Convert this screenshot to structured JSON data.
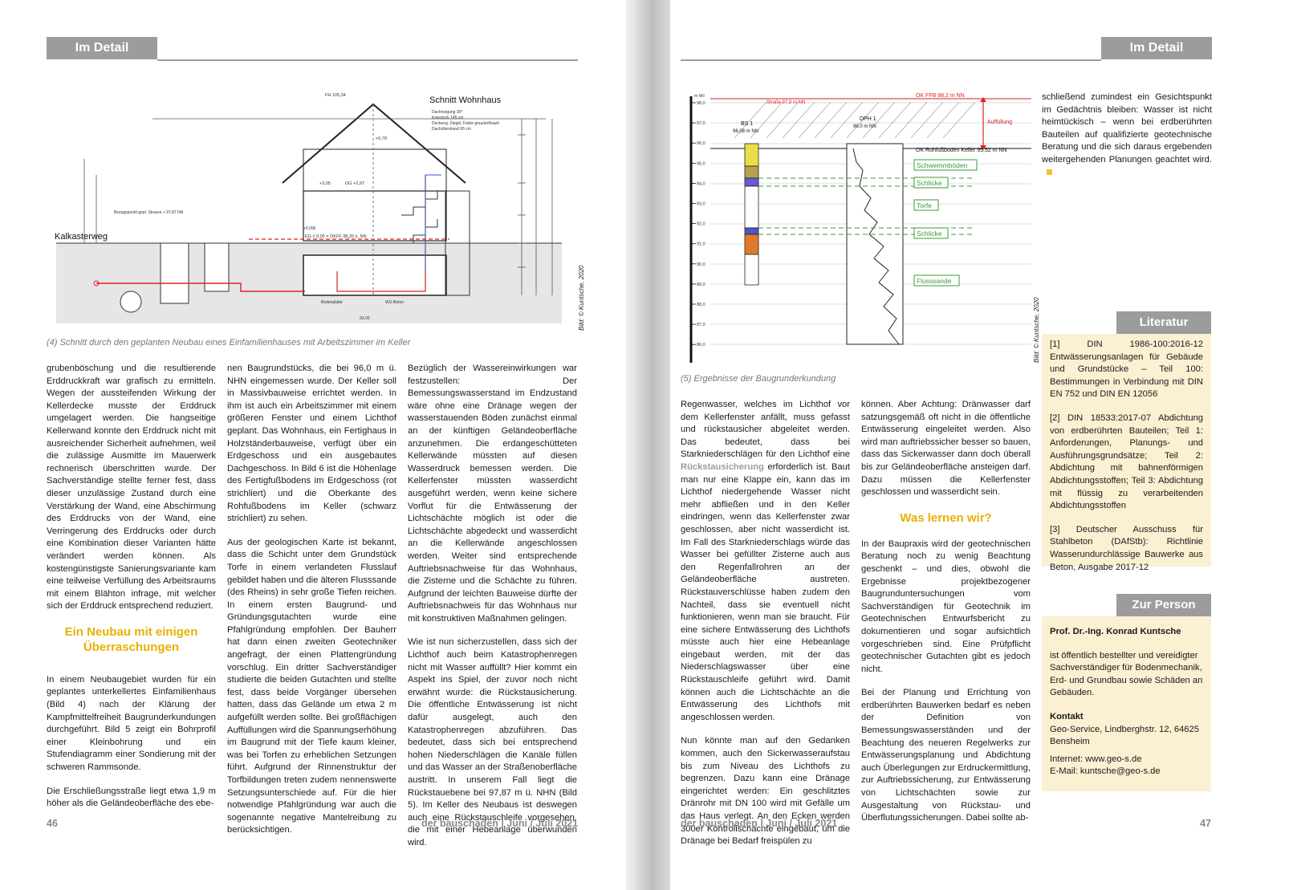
{
  "header": {
    "left_label": "Im Detail",
    "right_label": "Im Detail"
  },
  "figure4": {
    "title": "Schnitt Wohnhaus",
    "street": "Kalkasterweg",
    "caption": "(4) Schnitt durch den geplanten Neubau eines Einfamilienhauses mit Arbeitszimmer im Keller",
    "credit": "Bild: © Kuntsche, 2020",
    "roof_notes": [
      "Dachneigung 30°",
      "Kniestock 145 cm",
      "Deckung: Ziegel, Farbe grau/anthrazit",
      "Dachüberstand 95 cm"
    ],
    "labels": {
      "fh": "FH 105,34",
      "eg": "EG ± 0,00 = OKFF 98,20 ü. NN",
      "og": "OG +2,97",
      "dg": "+5,78",
      "eg2": "+3,05",
      "bezug": "Bezugspunkt gepl. Strasse + 97,87 NN",
      "kellersohle": "+0,095",
      "bodenplatte": "Bodenplatte",
      "wasserdicht": "WU-Beton",
      "abs": "93,00"
    }
  },
  "figure5": {
    "caption": "(5) Ergebnisse der Baugrunderkundung",
    "credit": "Bild: © Kuntsche, 2020",
    "ok_ffb": "OK FFB 98,2 m NN",
    "strasse": "Straße 97,8 m NN",
    "ok_rohfussboden": "OK Rohfußboden Keller 95,52 m NN",
    "auffuellung": "Auffüllung",
    "bs1": "BS 1",
    "bs1_level": "96,08 m NN",
    "dph1": "DPH 1",
    "dph1_level": "96,0 m NN",
    "axis_label": "m NN",
    "y_ticks": [
      "98,0",
      "97,0",
      "96,0",
      "95,0",
      "94,0",
      "93,0",
      "92,0",
      "91,0",
      "90,0",
      "89,0",
      "88,0",
      "87,0",
      "86,0"
    ],
    "layers": [
      "Schwemmböden",
      "Schlicke",
      "Torfe",
      "Schlicke",
      "Flusssande"
    ]
  },
  "left": {
    "col1": {
      "p1": "grubenböschung und die resultierende Erddruckkraft war grafisch zu ermitteln. Wegen der aussteifenden Wirkung der Kellerdecke musste der Erddruck umgelagert werden. Die hangseitige Kellerwand konnte den Erddruck nicht mit ausreichender Sicherheit aufnehmen, weil die zulässige Ausmitte im Mauerwerk rechnerisch überschritten wurde. Der Sachverständige stellte ferner fest, dass dieser unzulässige Zustand durch eine Verstärkung der Wand, eine Abschirmung des Erddrucks von der Wand, eine Verringerung des Erddrucks oder durch eine Kombination dieser Varianten hätte verändert werden können. Als kostengünstigste Sanierungsvariante kam eine teilweise Verfüllung des Arbeitsraums mit einem Blähton infrage, mit welcher sich der Erddruck entsprechend reduziert.",
      "heading": "Ein Neubau mit einigen Überraschungen",
      "p2": "In einem Neubaugebiet wurden für ein geplantes unterkellertes Einfamilienhaus (Bild 4) nach der Klärung der Kampfmittelfreiheit Baugrunderkundungen durchgeführt. Bild 5 zeigt ein Bohrprofil einer Kleinbohrung und ein Stufendiagramm einer Sondierung mit der schweren Rammsonde.",
      "p3": "Die Erschließungsstraße liegt etwa 1,9 m höher als die Geländeoberfläche des ebe-"
    },
    "col2": {
      "p1": "nen Baugrundstücks, die bei 96,0 m ü. NHN eingemessen wurde. Der Keller soll in Massivbauweise errichtet werden. In ihm ist auch ein Arbeitszimmer mit einem größeren Fenster und einem Lichthof geplant. Das Wohnhaus, ein Fertighaus in Holzständerbauweise, verfügt über ein Erdgeschoss und ein ausgebautes Dachgeschoss. In Bild 6 ist die Höhenlage des Fertigfußbodens im Erdgeschoss (rot strichliert) und die Oberkante des Rohfußbodens im Keller (schwarz strichliert) zu sehen.",
      "p2": "Aus der geologischen Karte ist bekannt, dass die Schicht unter dem Grundstück Torfe in einem verlandeten Flusslauf gebildet haben und die älteren Flusssande (des Rheins) in sehr große Tiefen reichen. In einem ersten Baugrund- und Gründungsgutachten wurde eine Pfahlgründung empfohlen. Der Bauherr hat dann einen zweiten Geotechniker angefragt, der einen Plattengründung vorschlug. Ein dritter Sachverständiger studierte die beiden Gutachten und stellte fest, dass beide Vorgänger übersehen hatten, dass das Gelände um etwa 2 m aufgefüllt werden sollte. Bei großflächigen Auffüllungen wird die Spannungserhöhung im Baugrund mit der Tiefe kaum kleiner, was bei Torfen zu erheblichen Setzungen führt. Aufgrund der Rinnenstruktur der Torfbildungen treten zudem nennenswerte Setzungsunterschiede auf. Für die hier notwendige Pfahlgründung war auch die sogenannte negative Mantelreibung zu berücksichtigen."
    },
    "col3": {
      "p1": "Bezüglich der Wassereinwirkungen war festzustellen: Der Bemessungswasserstand im Endzustand wäre ohne eine Dränage wegen der wasserstauenden Böden zunächst einmal an der künftigen Geländeoberfläche anzunehmen. Die erdangeschütteten Kellerwände müssten auf diesen Wasserdruck bemessen werden. Die Kellerfenster müssten wasserdicht ausgeführt werden, wenn keine sichere Vorflut für die Entwässerung der Lichtschächte möglich ist oder die Lichtschächte abgedeckt und wasserdicht an die Kellerwände angeschlossen werden. Weiter sind entsprechende Auftriebsnachweise für das Wohnhaus, die Zisterne und die Schächte zu führen. Aufgrund der leichten Bauweise dürfte der Auftriebsnachweis für das Wohnhaus nur mit konstruktiven Maßnahmen gelingen.",
      "p2": "Wie ist nun sicherzustellen, dass sich der Lichthof auch beim Katastrophenregen nicht mit Wasser auffüllt? Hier kommt ein Aspekt ins Spiel, der zuvor noch nicht erwähnt wurde: die Rückstausicherung. Die öffentliche Entwässerung ist nicht dafür ausgelegt, auch den Katastrophenregen abzuführen. Das bedeutet, dass sich bei entsprechend hohen Niederschlägen die Kanäle füllen und das Wasser an der Straßenoberfläche austritt. In unserem Fall liegt die Rückstauebene bei 97,87 m ü. NHN (Bild 5). Im Keller des Neubaus ist deswegen auch eine Rückstauschleife vorgesehen, die mit einer Hebeanlage überwunden wird."
    },
    "folio_num": "46",
    "folio_title": "der bauschaden | Juni / Juli 2021"
  },
  "right": {
    "col1": {
      "p1_a": "Regenwasser, welches im Lichthof vor dem Kellerfenster anfällt, muss gefasst und rückstausicher abgeleitet werden. Das bedeutet, dass bei Starkniederschlägen für den Lichthof eine ",
      "p1_hl": "Rückstausicherung",
      "p1_b": " erforderlich ist. Baut man nur eine Klappe ein, kann das im Lichthof niedergehende Wasser nicht mehr abfließen und in den Keller eindringen, wenn das Kellerfenster zwar geschlossen, aber nicht wasserdicht ist. Im Fall des Starkniederschlags würde das Wasser bei gefüllter Zisterne auch aus den Regenfallrohren an der Geländeoberfläche austreten. Rückstauverschlüsse haben zudem den Nachteil, dass sie eventuell nicht funktionieren, wenn man sie braucht. Für eine sichere Entwässerung des Lichthofs müsste auch hier eine Hebeanlage eingebaut werden, mit der das Niederschlagswasser über eine Rückstauschleife geführt wird. Damit können auch die Lichtschächte an die Entwässerung des Lichthofs mit angeschlossen werden.",
      "p2": "Nun könnte man auf den Gedanken kommen, auch den Sickerwasseraufstau bis zum Niveau des Lichthofs zu begrenzen. Dazu kann eine Dränage eingerichtet werden: Ein geschlitztes Dränrohr mit DN 100 wird mit Gefälle um das Haus verlegt. An den Ecken werden 300er Kontrollschächte eingebaut, um die Dränage bei Bedarf freispülen zu"
    },
    "col2": {
      "p1": "können. Aber Achtung: Dränwasser darf satzungsgemäß oft nicht in die öffentliche Entwässerung eingeleitet werden. Also wird man auftriebssicher besser so bauen, dass das Sickerwasser dann doch überall bis zur Geländeoberfläche ansteigen darf. Dazu müssen die Kellerfenster geschlossen und wasserdicht sein.",
      "heading": "Was lernen wir?",
      "p2": "In der Baupraxis wird der geotechnischen Beratung noch zu wenig Beachtung geschenkt – und dies, obwohl die Ergebnisse projektbezogener Baugrunduntersuchungen vom Sachverständigen für Geotechnik im Geotechnischen Entwurfsbericht zu dokumentieren und sogar aufsichtlich vorgeschrieben sind. Eine Prüfpflicht geotechnischer Gutachten gibt es jedoch nicht.",
      "p3": "Bei der Planung und Errichtung von erdberührten Bauwerken bedarf es neben der Definition von Bemessungswasserständen und der Beachtung des neueren Regelwerks zur Entwässerungsplanung und Abdichtung auch Überlegungen zur Erdruckermittlung, zur Auftriebssicherung, zur Entwässerung von Lichtschächten sowie zur Ausgestaltung von Rückstau- und Überflutungssicherungen. Dabei sollte ab-"
    },
    "col3": {
      "p1": "schließend zumindest ein Gesichtspunkt im Gedächtnis bleiben: Wasser ist nicht heimtückisch – wenn bei erdberührten Bauteilen auf qualifizierte geotechnische Beratung und die sich daraus ergebenden weitergehenden Planungen geachtet wird."
    },
    "literatur": {
      "title": "Literatur",
      "refs": [
        "[1] DIN 1986-100:2016-12 Entwässerungsanlagen für Gebäude und Grundstücke – Teil 100: Bestimmungen in Verbindung mit DIN EN 752 und DIN EN 12056",
        "[2] DIN 18533:2017-07 Abdichtung von erdberührten Bauteilen; Teil 1: Anforderungen, Planungs- und Ausführungsgrundsätze; Teil 2: Abdichtung mit bahnenförmigen Abdichtungsstoffen; Teil 3: Abdichtung mit flüssig zu verarbeitenden Abdichtungsstoffen",
        "[3] Deutscher Ausschuss für Stahlbeton (DAfStb): Richtlinie Wasserundurchlässige Bauwerke aus Beton, Ausgabe 2017-12"
      ]
    },
    "person": {
      "title": "Zur Person",
      "name": "Prof. Dr.-Ing. Konrad Kuntsche",
      "bio": "ist öffentlich bestellter und vereidigter Sachverständiger für Bodenmechanik, Erd- und Grundbau sowie Schäden an Gebäuden.",
      "kontakt_label": "Kontakt",
      "address": "Geo-Service, Lindberghstr. 12, 64625 Bensheim",
      "internet": "Internet: www.geo-s.de",
      "email": "E-Mail: kuntsche@geo-s.de"
    },
    "folio_title": "der bauschaden | Juni / Juli 2021",
    "folio_num": "47"
  },
  "colors": {
    "accent": "#e8b000",
    "header_gray": "#9c9c9c",
    "box_bg": "#fbf0d2"
  }
}
